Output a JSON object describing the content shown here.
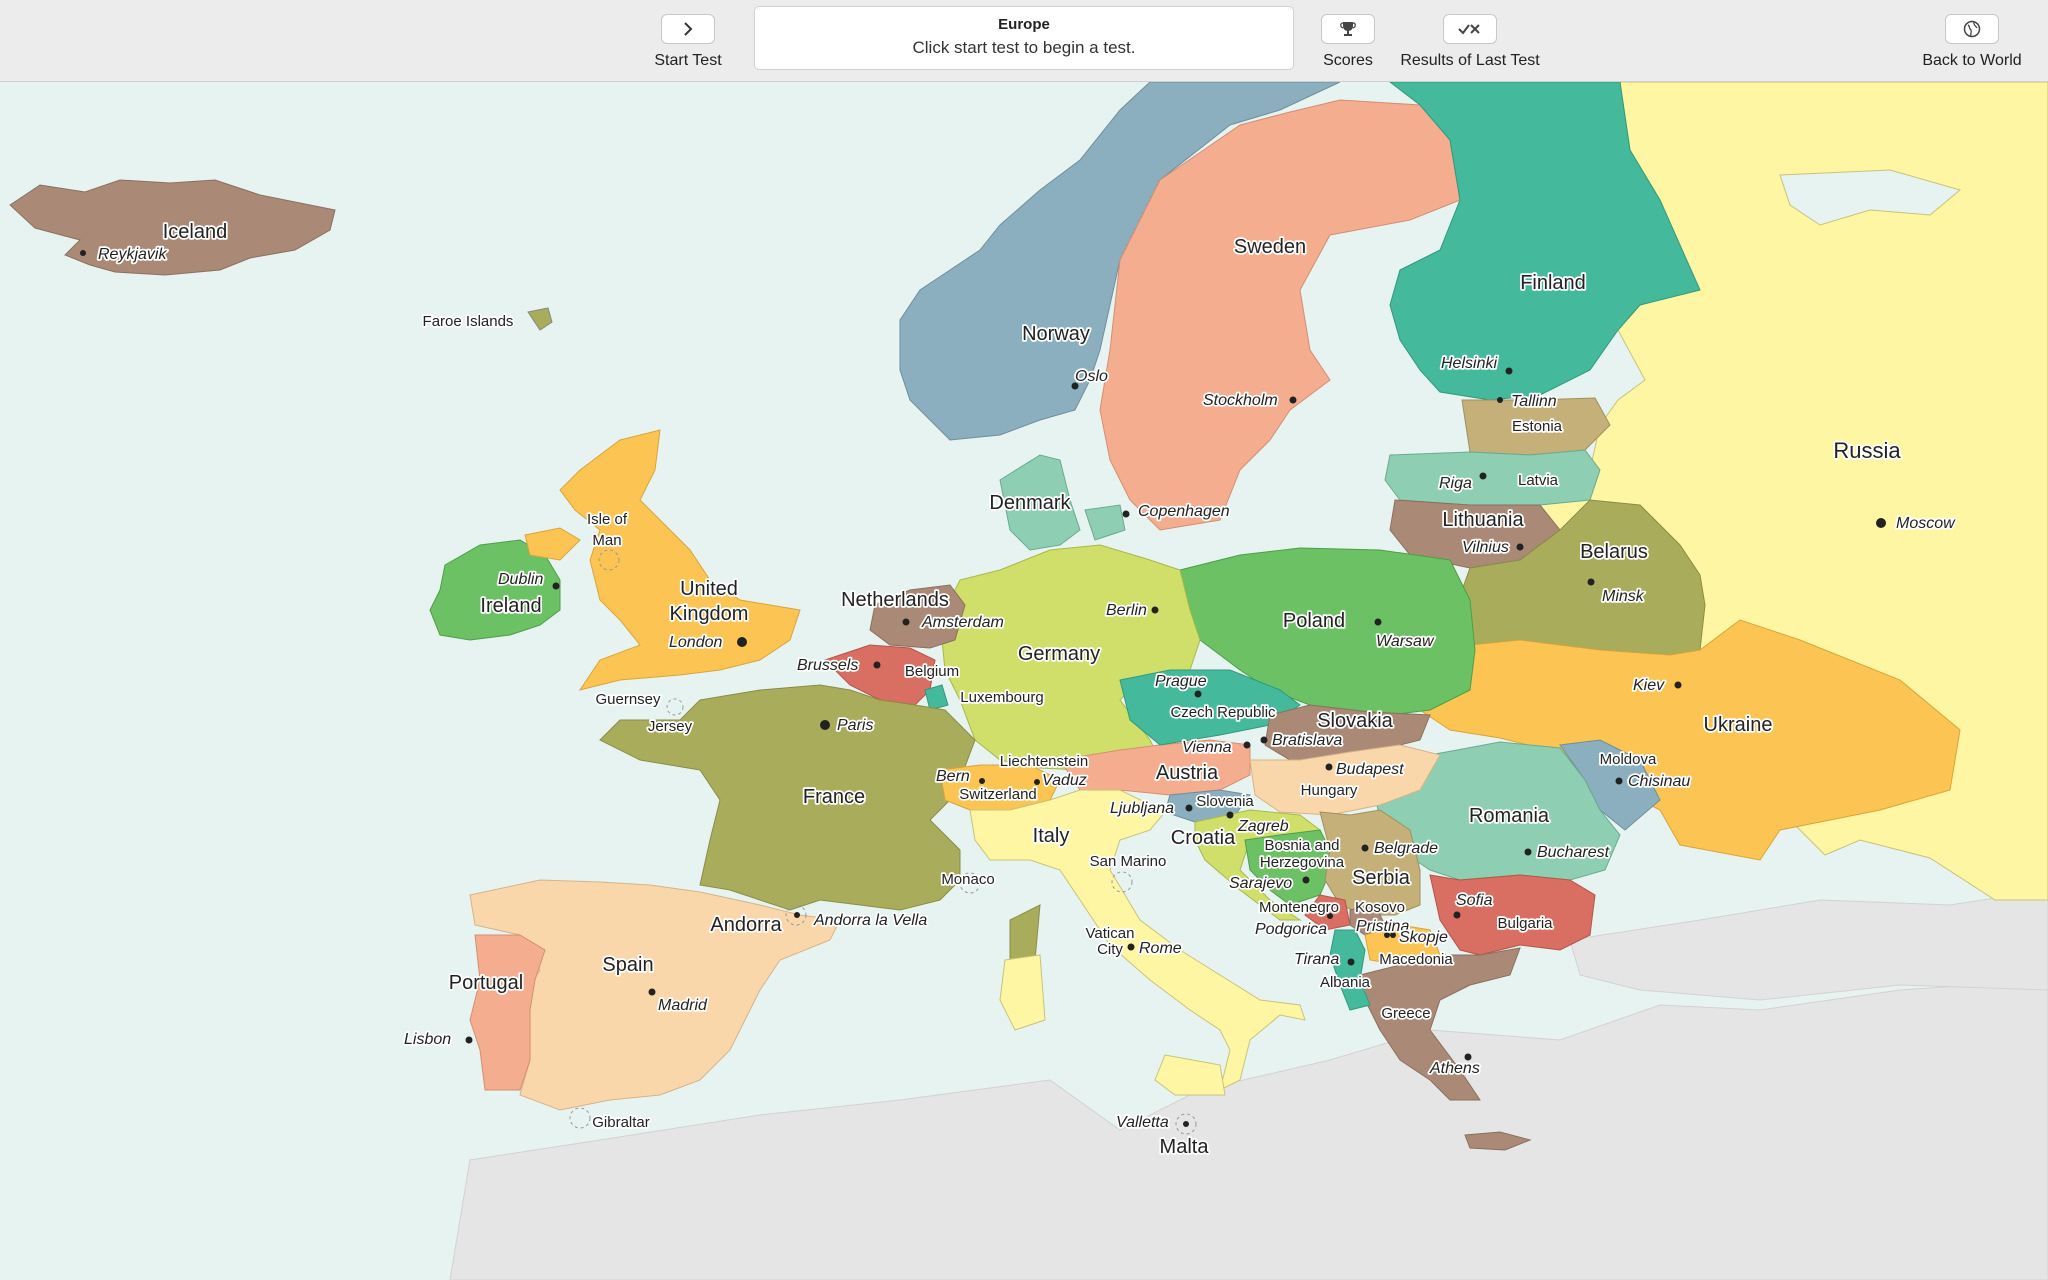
{
  "toolbar": {
    "start_label": "Start Test",
    "scores_label": "Scores",
    "results_label": "Results of Last Test",
    "back_label": "Back to World",
    "status_title": "Europe",
    "status_message": "Click start test to begin a test."
  },
  "colors": {
    "sea": "#e6f3f1",
    "land_other": "#e5e5e5",
    "accent_pink": "#f4ad8f",
    "accent_blue": "#8bafbf",
    "accent_teal": "#45b99b",
    "accent_yellow": "#fff6a3",
    "accent_orange": "#fcc452",
    "accent_green": "#6bc163",
    "accent_olive": "#a9ad5b",
    "accent_brown": "#aa8a76"
  },
  "map": {
    "countries": {
      "iceland": "Iceland",
      "faroe": "Faroe Islands",
      "norway": "Norway",
      "sweden": "Sweden",
      "finland": "Finland",
      "russia": "Russia",
      "estonia": "Estonia",
      "latvia": "Latvia",
      "lithuania": "Lithuania",
      "belarus": "Belarus",
      "ukraine": "Ukraine",
      "moldova": "Moldova",
      "romania": "Romania",
      "bulgaria": "Bulgaria",
      "greece": "Greece",
      "denmark": "Denmark",
      "poland": "Poland",
      "germany": "Germany",
      "netherlands": "Netherlands",
      "belgium": "Belgium",
      "luxembourg": "Luxembourg",
      "france": "France",
      "uk_line1": "United",
      "uk_line2": "Kingdom",
      "ireland": "Ireland",
      "iom_line1": "Isle of",
      "iom_line2": "Man",
      "guernsey": "Guernsey",
      "jersey": "Jersey",
      "spain": "Spain",
      "portugal": "Portugal",
      "andorra": "Andorra",
      "gibraltar": "Gibraltar",
      "monaco": "Monaco",
      "italy": "Italy",
      "switzerland": "Switzerland",
      "liechtenstein": "Liechtenstein",
      "austria": "Austria",
      "czech": "Czech Republic",
      "slovakia": "Slovakia",
      "hungary": "Hungary",
      "slovenia": "Slovenia",
      "croatia": "Croatia",
      "bih_line1": "Bosnia and",
      "bih_line2": "Herzegovina",
      "serbia": "Serbia",
      "montenegro": "Montenegro",
      "kosovo": "Kosovo",
      "albania": "Albania",
      "macedonia": "Macedonia",
      "san_marino": "San Marino",
      "vatican_line1": "Vatican",
      "vatican_line2": "City",
      "malta": "Malta"
    },
    "capitals": {
      "reykjavik": "Reykjavik",
      "oslo": "Oslo",
      "stockholm": "Stockholm",
      "helsinki": "Helsinki",
      "tallinn": "Tallinn",
      "riga": "Riga",
      "vilnius": "Vilnius",
      "minsk": "Minsk",
      "moscow": "Moscow",
      "kiev": "Kiev",
      "chisinau": "Chisinau",
      "bucharest": "Bucharest",
      "sofia": "Sofia",
      "athens": "Athens",
      "copenhagen": "Copenhagen",
      "warsaw": "Warsaw",
      "berlin": "Berlin",
      "amsterdam": "Amsterdam",
      "brussels": "Brussels",
      "paris": "Paris",
      "london": "London",
      "dublin": "Dublin",
      "madrid": "Madrid",
      "lisbon": "Lisbon",
      "andorra_la_vella": "Andorra la Vella",
      "rome": "Rome",
      "bern": "Bern",
      "vaduz": "Vaduz",
      "vienna": "Vienna",
      "prague": "Prague",
      "bratislava": "Bratislava",
      "budapest": "Budapest",
      "ljubljana": "Ljubljana",
      "zagreb": "Zagreb",
      "sarajevo": "Sarajevo",
      "belgrade": "Belgrade",
      "podgorica": "Podgorica",
      "pristina": "Pristina",
      "skopje": "Skopje",
      "tirana": "Tirana",
      "valletta": "Valletta"
    }
  }
}
